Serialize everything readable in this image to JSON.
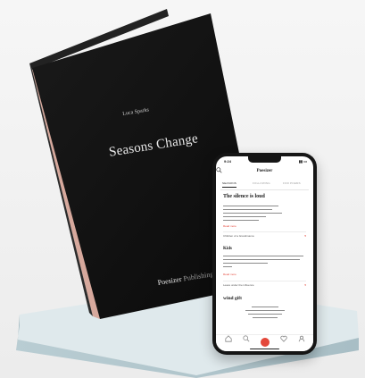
{
  "book": {
    "author": "Luca Sparks",
    "title": "Seasons Change",
    "publisher_dark": "Poesizer",
    "publisher_light": "Publishing"
  },
  "phone": {
    "status_time": "9:24",
    "app_title": "Poesizer",
    "tabs": [
      "SEASONS",
      "FOLLOWING",
      "FOR POEMS"
    ],
    "poems": [
      {
        "title": "The silence is loud"
      },
      {
        "title": "Kids"
      },
      {
        "title": "wind gift"
      }
    ],
    "read_more": "Read more",
    "list_items": [
      {
        "title": "Children of a Grandmama"
      },
      {
        "title": "Leave under the influence"
      }
    ],
    "colors": {
      "accent": "#e4473a",
      "book_cover": "#111111"
    }
  }
}
